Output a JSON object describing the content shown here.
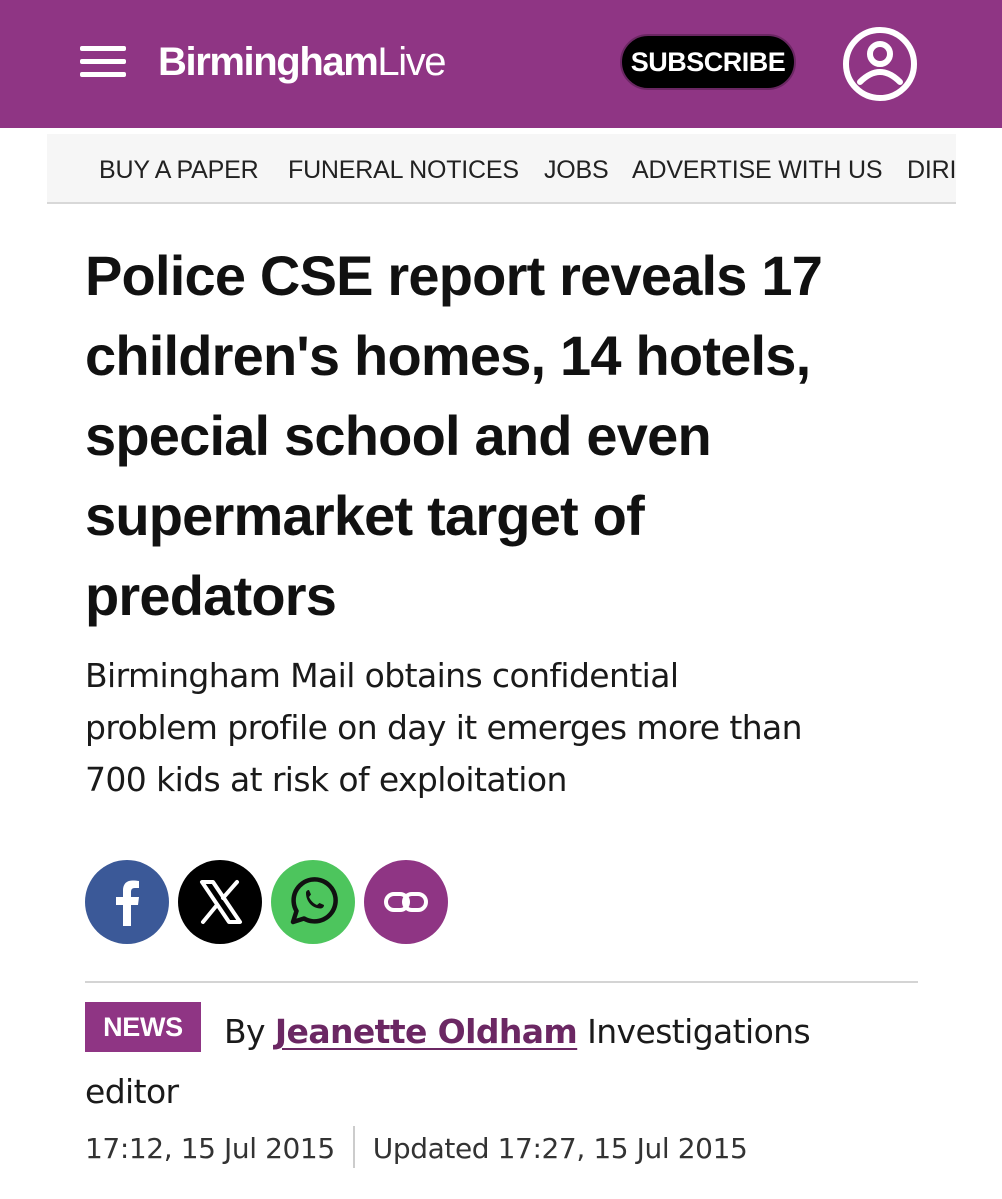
{
  "header": {
    "logo_bold": "Birmingham",
    "logo_light": "Live",
    "subscribe_label": "SUBSCRIBE",
    "brand_color": "#8f3584"
  },
  "nav": {
    "items": [
      {
        "label": "BUY A PAPER"
      },
      {
        "label": "FUNERAL NOTICES"
      },
      {
        "label": "JOBS"
      },
      {
        "label": "ADVERTISE WITH US"
      },
      {
        "label": "DIRI"
      }
    ]
  },
  "article": {
    "headline_lines": [
      "Police CSE report reveals 17",
      "children's homes, 14 hotels,",
      "special school and even",
      "supermarket target of",
      "predators"
    ],
    "standfirst_lines": [
      "Birmingham Mail obtains confidential",
      "problem profile on day it emerges more than",
      "700 kids at risk of exploitation"
    ],
    "share": [
      {
        "icon": "facebook-icon"
      },
      {
        "icon": "x-icon"
      },
      {
        "icon": "whatsapp-icon"
      },
      {
        "icon": "link-icon"
      }
    ],
    "category_badge": "NEWS",
    "byline_prefix": "By ",
    "author": "Jeanette Oldham",
    "role_part1": " Investigations",
    "role_part2": "editor",
    "published": "17:12, 15 Jul 2015",
    "updated": "Updated 17:27, 15 Jul 2015"
  }
}
